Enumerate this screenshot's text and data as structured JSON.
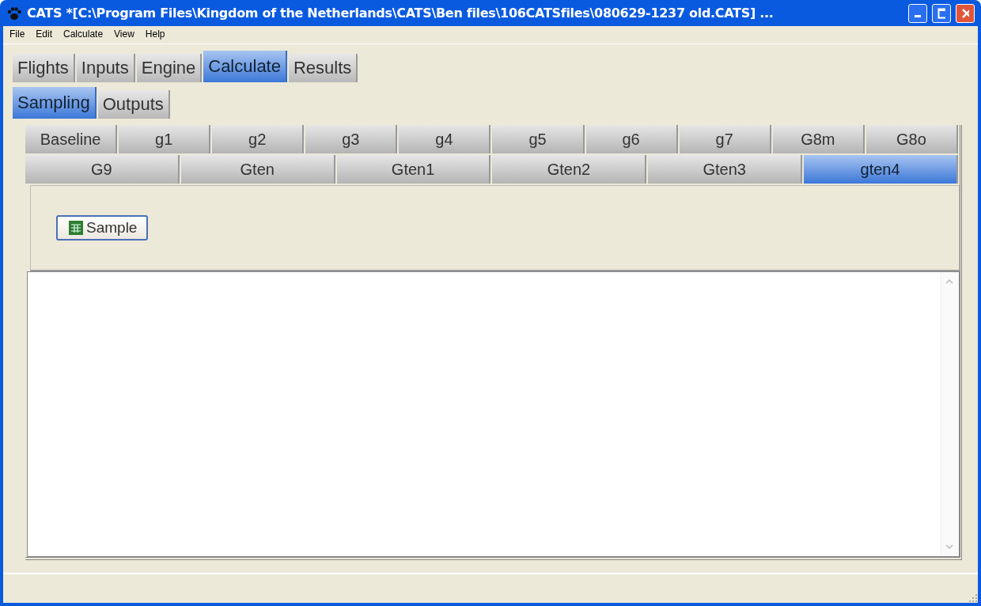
{
  "window": {
    "title": "CATS *[C:\\Program Files\\Kingdom of the Netherlands\\CATS\\Ben files\\106CATSfiles\\080629-1237 old.CATS] ..."
  },
  "menu": [
    "File",
    "Edit",
    "Calculate",
    "View",
    "Help"
  ],
  "main_tabs": [
    {
      "label": "Flights",
      "selected": false
    },
    {
      "label": "Inputs",
      "selected": false
    },
    {
      "label": "Engine",
      "selected": false
    },
    {
      "label": "Calculate",
      "selected": true
    },
    {
      "label": "Results",
      "selected": false
    }
  ],
  "sub_tabs": [
    {
      "label": "Sampling",
      "selected": true
    },
    {
      "label": "Outputs",
      "selected": false
    }
  ],
  "group_tab_rows": [
    [
      {
        "label": "Baseline",
        "selected": false
      },
      {
        "label": "g1",
        "selected": false
      },
      {
        "label": "g2",
        "selected": false
      },
      {
        "label": "g3",
        "selected": false
      },
      {
        "label": "g4",
        "selected": false
      },
      {
        "label": "g5",
        "selected": false
      },
      {
        "label": "g6",
        "selected": false
      },
      {
        "label": "g7",
        "selected": false
      },
      {
        "label": "G8m",
        "selected": false
      },
      {
        "label": "G8o",
        "selected": false
      }
    ],
    [
      {
        "label": "G9",
        "selected": false
      },
      {
        "label": "Gten",
        "selected": false
      },
      {
        "label": "Gten1",
        "selected": false
      },
      {
        "label": "Gten2",
        "selected": false
      },
      {
        "label": "Gten3",
        "selected": false
      },
      {
        "label": "gten4",
        "selected": true
      }
    ]
  ],
  "sample_button": {
    "label": "Sample"
  }
}
